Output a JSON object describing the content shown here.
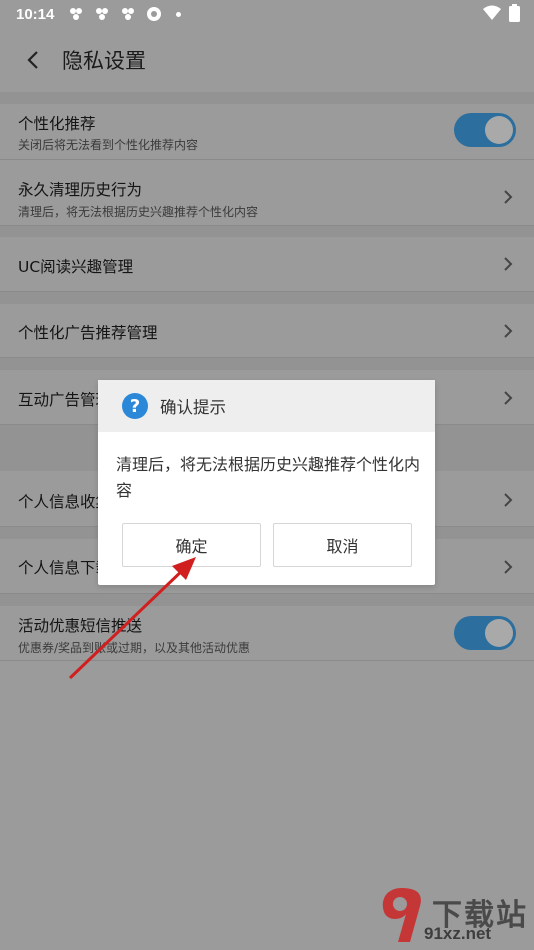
{
  "status": {
    "time": "10:14"
  },
  "header": {
    "title": "隐私设置"
  },
  "rows": [
    {
      "label": "个性化推荐",
      "sub": "关闭后将无法看到个性化推荐内容",
      "control": "toggle-on"
    },
    {
      "label": "永久清理历史行为",
      "sub": "清理后，将无法根据历史兴趣推荐个性化内容",
      "control": "chevron"
    },
    {
      "label": "UC阅读兴趣管理",
      "control": "chevron"
    },
    {
      "label": "个性化广告推荐管理",
      "control": "chevron"
    },
    {
      "label": "互动广告管理",
      "control": "chevron"
    },
    {
      "label": "个人信息收集",
      "control": "chevron"
    },
    {
      "label": "个人信息下载",
      "control": "chevron"
    },
    {
      "label": "活动优惠短信推送",
      "sub": "优惠券/奖品到账或过期，以及其他活动优惠",
      "control": "toggle-on"
    }
  ],
  "dialog": {
    "title": "确认提示",
    "message": "清理后，将无法根据历史兴趣推荐个性化内容",
    "confirm": "确定",
    "cancel": "取消"
  },
  "watermark": {
    "brand": "下载站",
    "url": "91xz.net"
  },
  "colors": {
    "toggle_on": "#2c6f9f",
    "dialog_icon": "#2b88d8",
    "annotation_arrow": "#d11f1f"
  }
}
